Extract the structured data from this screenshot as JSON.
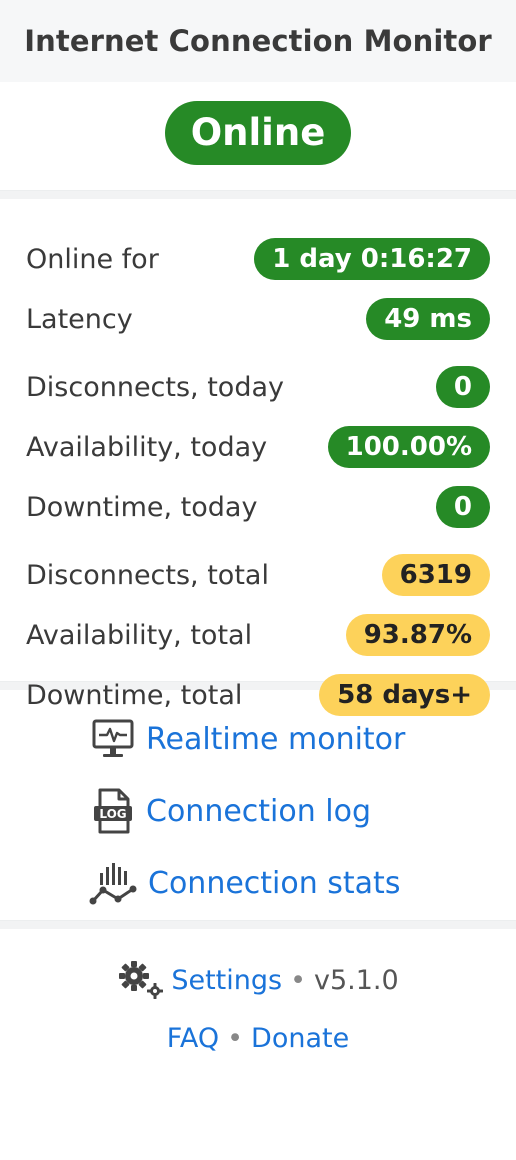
{
  "header": {
    "title": "Internet Connection Monitor"
  },
  "status": {
    "label": "Online",
    "color": "#268a26"
  },
  "stats": [
    {
      "label": "Online for",
      "value": "1 day 0:16:27",
      "tone": "green"
    },
    {
      "label": "Latency",
      "value": "49 ms",
      "tone": "green"
    },
    {
      "label": "Disconnects, today",
      "value": "0",
      "tone": "green"
    },
    {
      "label": "Availability, today",
      "value": "100.00%",
      "tone": "green"
    },
    {
      "label": "Downtime, today",
      "value": "0",
      "tone": "green"
    },
    {
      "label": "Disconnects, total",
      "value": "6319",
      "tone": "yellow"
    },
    {
      "label": "Availability, total",
      "value": "93.87%",
      "tone": "yellow"
    },
    {
      "label": "Downtime, total",
      "value": "58 days+",
      "tone": "yellow"
    }
  ],
  "links": {
    "realtime": {
      "label": "Realtime monitor",
      "icon": "monitor-icon"
    },
    "log": {
      "label": "Connection log",
      "icon": "log-file-icon"
    },
    "stats": {
      "label": "Connection stats",
      "icon": "stats-chart-icon"
    }
  },
  "footer": {
    "settings_label": "Settings",
    "settings_icon": "gears-icon",
    "separator": "•",
    "version": "v5.1.0",
    "faq_label": "FAQ",
    "donate_label": "Donate"
  },
  "colors": {
    "green": "#268a26",
    "yellow": "#fdd25a",
    "link": "#1a73d9"
  }
}
